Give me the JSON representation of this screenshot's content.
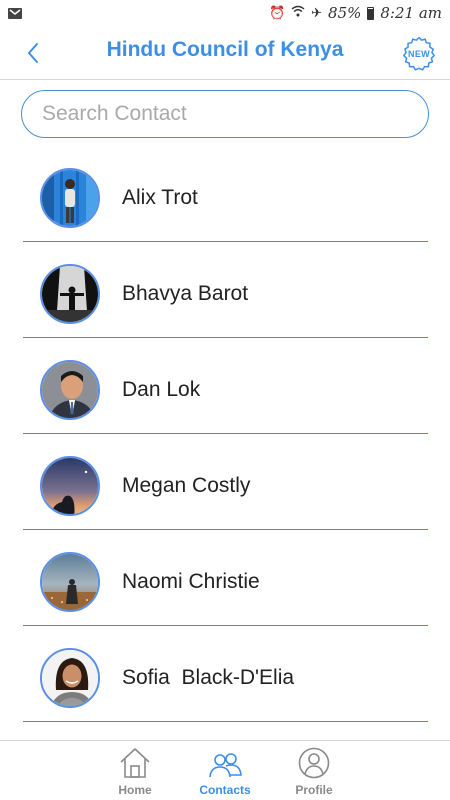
{
  "status_bar": {
    "battery": "85%",
    "time": "8:21 am",
    "icons": [
      "gmail-icon",
      "alarm-icon",
      "wifi-icon",
      "airplane-icon",
      "battery-icon"
    ]
  },
  "header": {
    "title": "Hindu Council of Kenya",
    "badge": "NEW",
    "accent_color": "#3d8fe6"
  },
  "search": {
    "placeholder": "Search Contact",
    "value": ""
  },
  "contacts": [
    {
      "name": "Alix Trot",
      "avatar_colors": [
        "#1e7fd6",
        "#5fb2f0"
      ]
    },
    {
      "name": "Bhavya Barot",
      "avatar_colors": [
        "#111111",
        "#d9d9d9"
      ]
    },
    {
      "name": "Dan Lok",
      "avatar_colors": [
        "#3a3e4a",
        "#d7a37e"
      ]
    },
    {
      "name": "Megan Costly",
      "avatar_colors": [
        "#2e3b63",
        "#d38a6a"
      ]
    },
    {
      "name": "Naomi Christie",
      "avatar_colors": [
        "#6e8ea6",
        "#b0703e"
      ]
    },
    {
      "name": "Sofia  Black-D'Elia",
      "avatar_colors": [
        "#f2f2f2",
        "#6b4a2f"
      ]
    }
  ],
  "tabs": [
    {
      "label": "Home",
      "icon": "home-icon",
      "active": false
    },
    {
      "label": "Contacts",
      "icon": "contacts-icon",
      "active": true
    },
    {
      "label": "Profile",
      "icon": "profile-icon",
      "active": false
    }
  ]
}
